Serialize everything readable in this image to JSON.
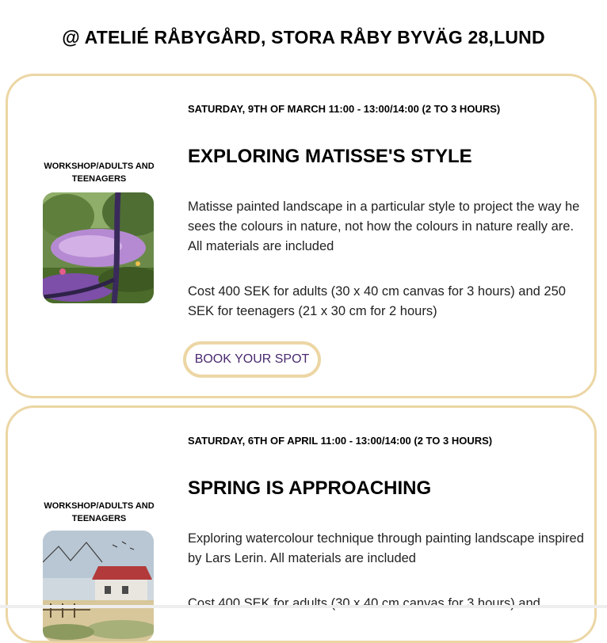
{
  "venue": "@ ATELIÉ RÅBYGÅRD, STORA RÅBY BYVÄG 28,LUND",
  "colors": {
    "border": "#ecd6a4",
    "button_text": "#4a2a6e"
  },
  "events": [
    {
      "category": "WORKSHOP/ADULTS AND TEENAGERS",
      "date": "SATURDAY, 9TH OF MARCH 11:00 - 13:00/14:00 (2 TO 3 HOURS)",
      "title": "EXPLORING MATISSE'S STYLE",
      "description": "Matisse painted landscape in a particular style to project the way he sees the colours in nature, not how the colours in nature really are. All materials are included",
      "cost": "Cost 400 SEK for adults (30 x 40 cm canvas for 3 hours) and 250 SEK for teenagers (21 x 30 cm for 2 hours)",
      "button": "BOOK YOUR SPOT",
      "image": "matisse-style-landscape-painting"
    },
    {
      "category": "WORKSHOP/ADULTS AND TEENAGERS",
      "date": "SATURDAY, 6TH OF APRIL 11:00 - 13:00/14:00 (2 TO 3 HOURS)",
      "title": "SPRING IS APPROACHING",
      "description": "Exploring watercolour technique through painting landscape inspired by Lars Lerin. All materials are included",
      "cost": "Cost 400 SEK for adults (30 x 40 cm canvas for 3 hours) and",
      "image": "watercolour-farmhouse-painting"
    }
  ]
}
